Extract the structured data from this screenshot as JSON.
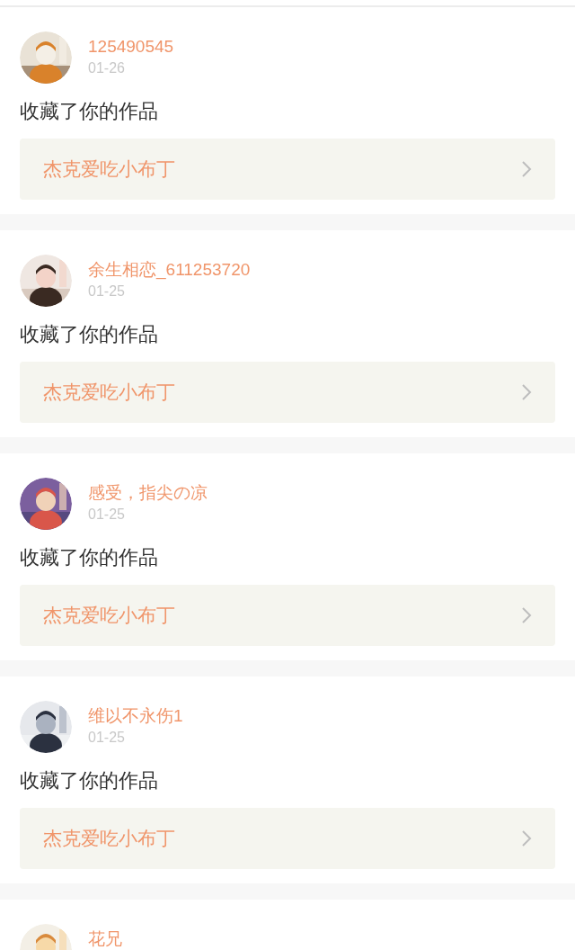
{
  "notifications": [
    {
      "name": "125490545",
      "date": "01-26",
      "action": "收藏了你的作品",
      "work": "杰克爱吃小布丁"
    },
    {
      "name": "余生相恋_611253720",
      "date": "01-25",
      "action": "收藏了你的作品",
      "work": "杰克爱吃小布丁"
    },
    {
      "name": "感受，指尖の凉",
      "date": "01-25",
      "action": "收藏了你的作品",
      "work": "杰克爱吃小布丁"
    },
    {
      "name": "维以不永伤1",
      "date": "01-25",
      "action": "收藏了你的作品",
      "work": "杰克爱吃小布丁"
    },
    {
      "name": "花兄"
    }
  ]
}
